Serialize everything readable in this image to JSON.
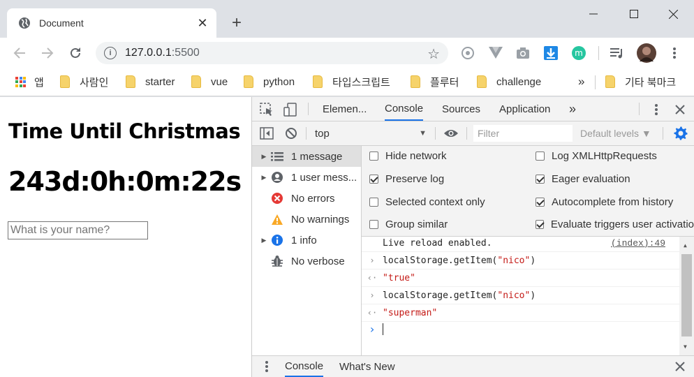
{
  "tab": {
    "title": "Document"
  },
  "toolbar": {
    "url_host": "127.0.0.1",
    "url_port": ":5500"
  },
  "bookmarks": [
    {
      "label": "앱",
      "type": "apps"
    },
    {
      "label": "사람인",
      "type": "folder"
    },
    {
      "label": "starter",
      "type": "folder"
    },
    {
      "label": "vue",
      "type": "folder"
    },
    {
      "label": "python",
      "type": "folder"
    },
    {
      "label": "타입스크립트",
      "type": "folder"
    },
    {
      "label": "플루터",
      "type": "folder"
    },
    {
      "label": "challenge",
      "type": "folder"
    },
    {
      "label": "»",
      "type": "overflow"
    },
    {
      "label": "기타 북마크",
      "type": "folder"
    }
  ],
  "page": {
    "heading": "Time Until Christmas",
    "countdown": "243d:0h:0m:22s",
    "name_placeholder": "What is your name?"
  },
  "devtools": {
    "tabs": [
      "Elemen...",
      "Console",
      "Sources",
      "Application"
    ],
    "active_tab": "Console",
    "overflow": "»",
    "context": "top",
    "filter_placeholder": "Filter",
    "levels": "Default levels ▼",
    "sidebar": [
      {
        "label": "1 message",
        "icon": "list-icon",
        "expandable": true,
        "selected": true
      },
      {
        "label": "1 user mess...",
        "icon": "user-icon",
        "expandable": true,
        "selected": false
      },
      {
        "label": "No errors",
        "icon": "error-icon",
        "expandable": false,
        "selected": false
      },
      {
        "label": "No warnings",
        "icon": "warning-icon",
        "expandable": false,
        "selected": false
      },
      {
        "label": "1 info",
        "icon": "info-icon",
        "expandable": true,
        "selected": false
      },
      {
        "label": "No verbose",
        "icon": "bug-icon",
        "expandable": false,
        "selected": false
      }
    ],
    "settings_left": [
      {
        "label": "Hide network",
        "checked": false
      },
      {
        "label": "Preserve log",
        "checked": true
      },
      {
        "label": "Selected context only",
        "checked": false
      },
      {
        "label": "Group similar",
        "checked": false
      }
    ],
    "settings_right": [
      {
        "label": "Log XMLHttpRequests",
        "checked": false
      },
      {
        "label": "Eager evaluation",
        "checked": true
      },
      {
        "label": "Autocomplete from history",
        "checked": true
      },
      {
        "label": "Evaluate triggers user activatio",
        "checked": true
      }
    ],
    "console": {
      "live_reload": "Live reload enabled.",
      "live_reload_src": "(index):49",
      "cmd1_prefix": "localStorage.getItem(",
      "cmd1_arg": "\"nico\"",
      "cmd1_suffix": ")",
      "res1": "\"true\"",
      "cmd2_prefix": "localStorage.getItem(",
      "cmd2_arg": "\"nico\"",
      "cmd2_suffix": ")",
      "res2": "\"superman\""
    },
    "drawer_tabs": [
      "Console",
      "What's New"
    ]
  },
  "colors": {
    "accent": "#1a73e8",
    "string": "#c41a16",
    "error": "#e53935",
    "warning": "#f9a825",
    "info": "#1a73e8"
  }
}
